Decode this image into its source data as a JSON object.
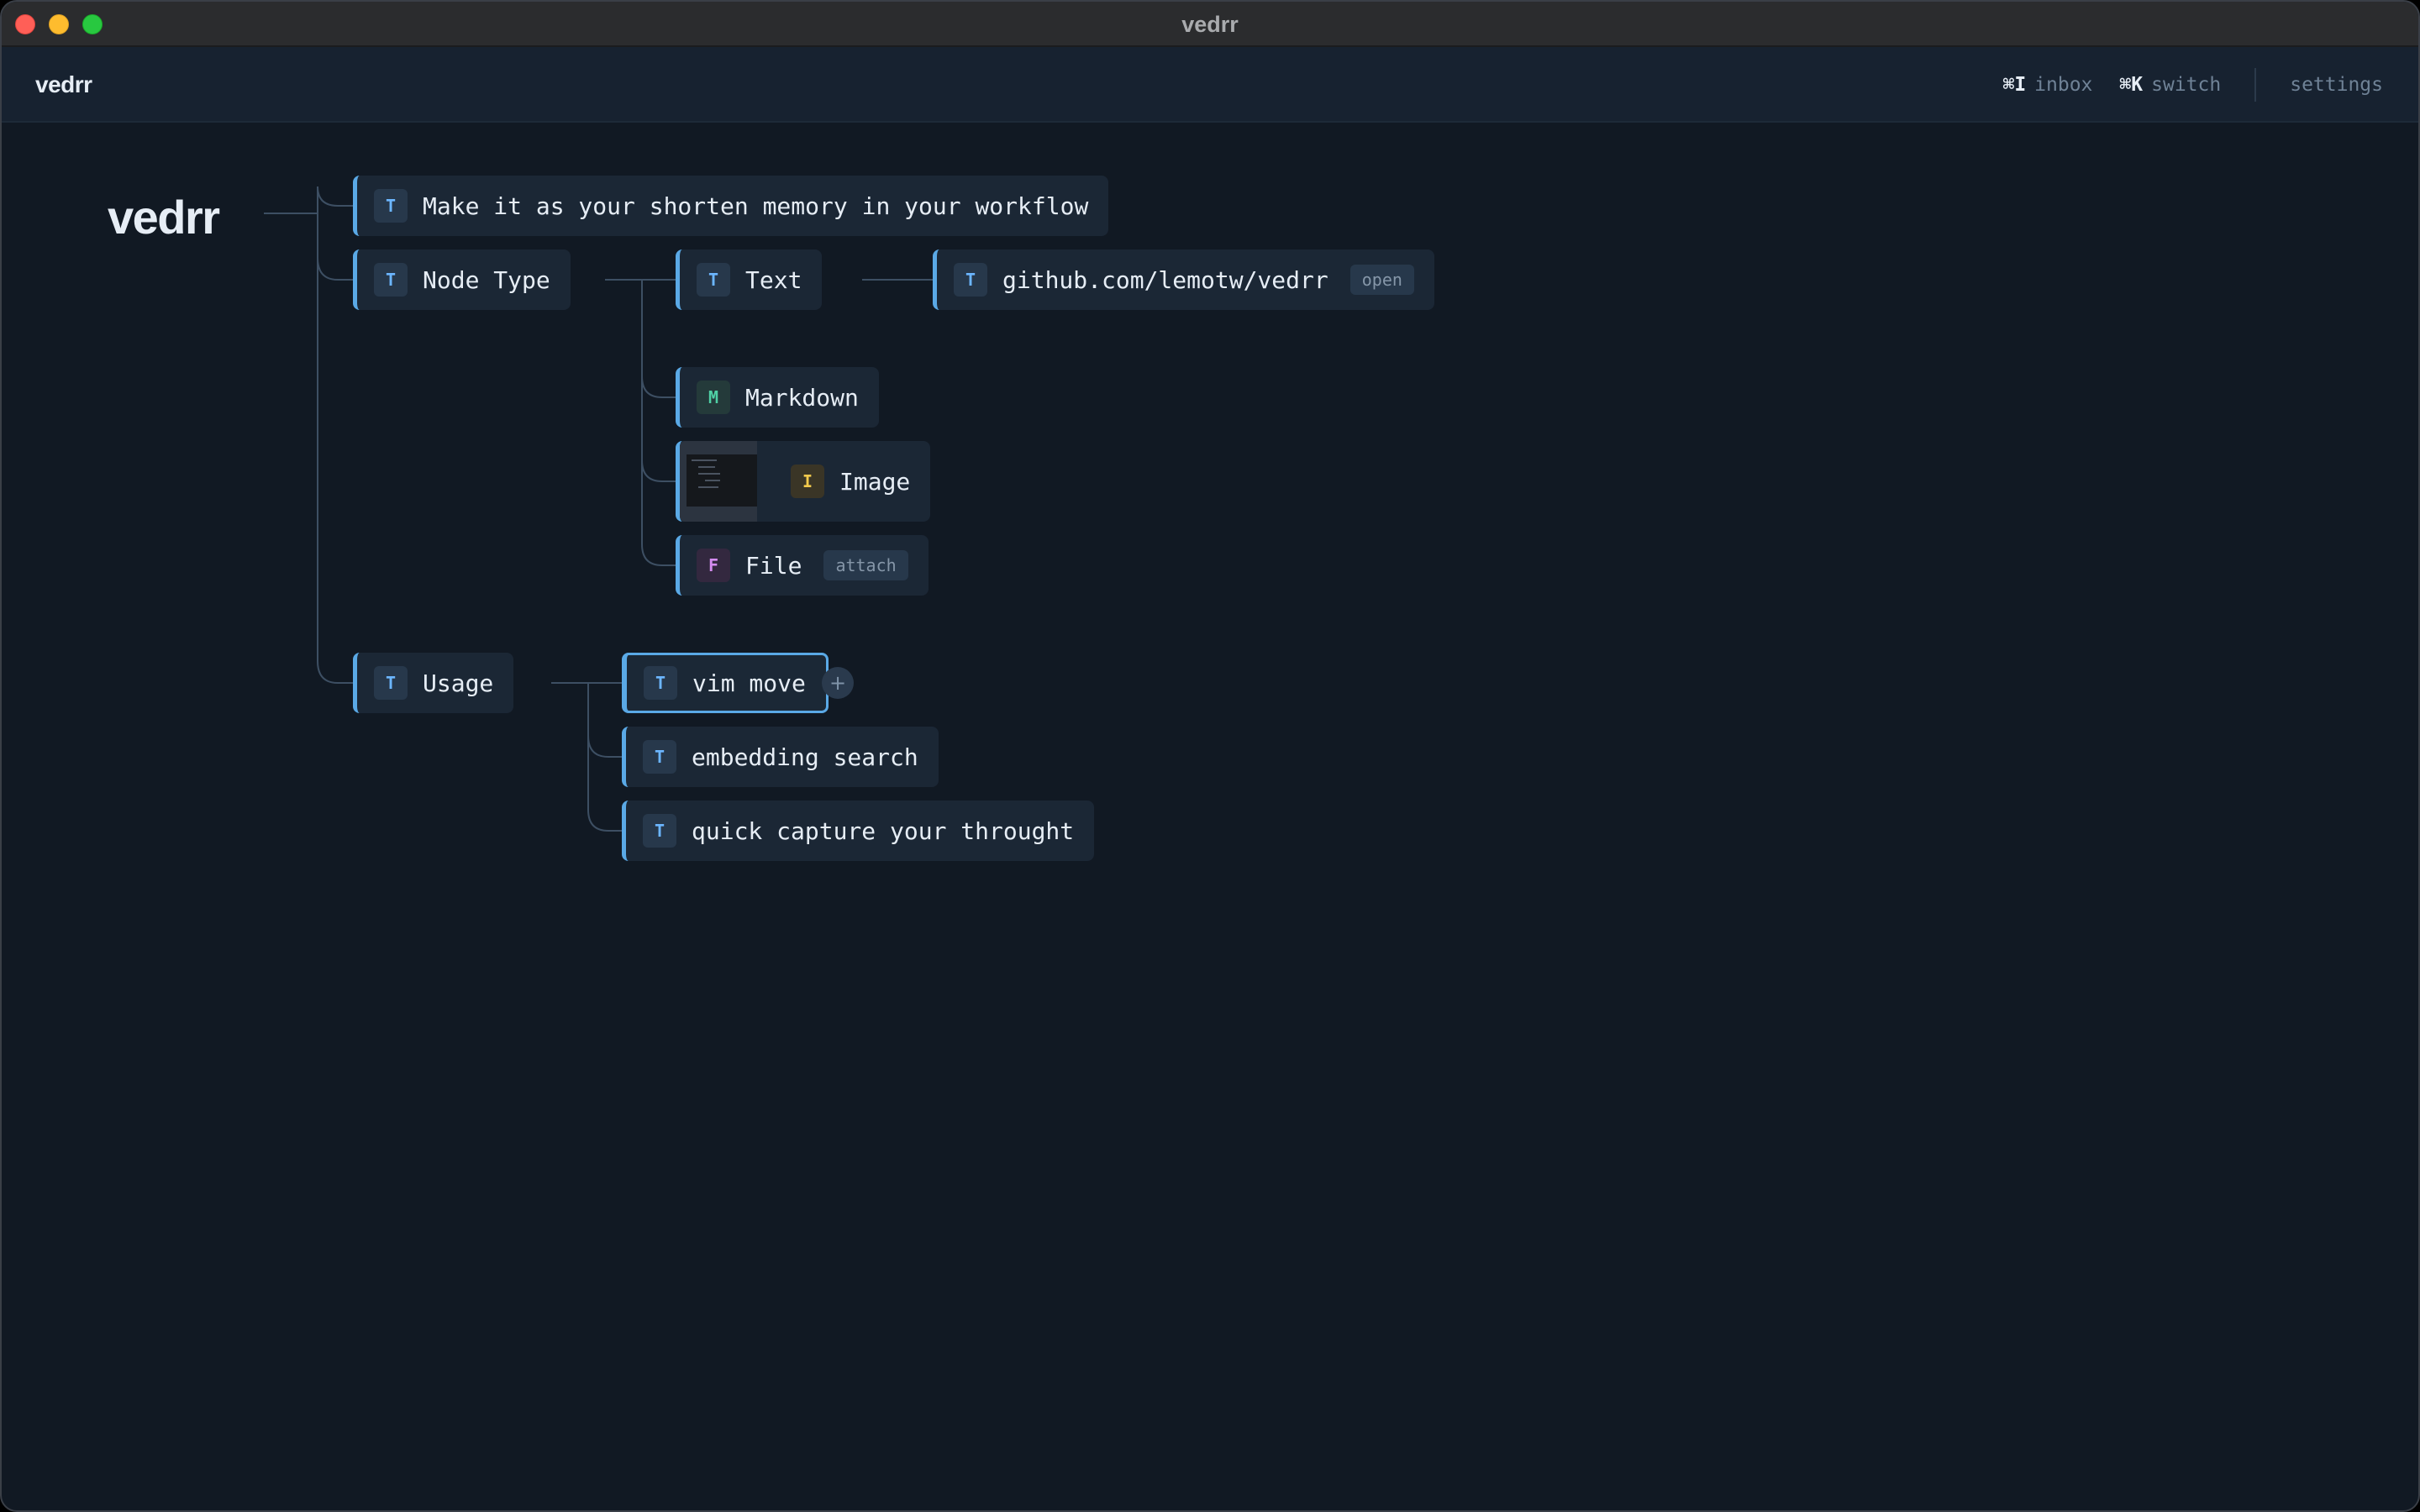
{
  "window": {
    "title": "vedrr"
  },
  "appbar": {
    "brand": "vedrr",
    "inbox": {
      "key": "⌘I",
      "label": "inbox"
    },
    "switch": {
      "key": "⌘K",
      "label": "switch"
    },
    "settings": "settings"
  },
  "tree": {
    "root": "vedrr",
    "nodes": {
      "memory": {
        "type": "T",
        "label": "Make it as your shorten memory in your workflow"
      },
      "node_type": {
        "type": "T",
        "label": "Node Type"
      },
      "text": {
        "type": "T",
        "label": "Text"
      },
      "github": {
        "type": "T",
        "label": "github.com/lemotw/vedrr",
        "tag": "open"
      },
      "markdown": {
        "type": "M",
        "label": "Markdown"
      },
      "image": {
        "type": "I",
        "label": "Image"
      },
      "file": {
        "type": "F",
        "label": "File",
        "tag": "attach"
      },
      "usage": {
        "type": "T",
        "label": "Usage"
      },
      "vim_move": {
        "type": "T",
        "label": "vim move",
        "selected": true
      },
      "embedding": {
        "type": "T",
        "label": "embedding search"
      },
      "capture": {
        "type": "T",
        "label": "quick capture your throught"
      }
    },
    "add_button": "+"
  },
  "colors": {
    "background": "#111923",
    "node_background": "#1b2735",
    "accent": "#5aa9e6",
    "text_type": "#6cb6ff",
    "markdown_type": "#4fd1a5",
    "image_type": "#f2c94c",
    "file_type": "#d58cf0"
  },
  "icons": {
    "close": "close-traffic-light",
    "minimize": "minimize-traffic-light",
    "zoom": "zoom-traffic-light",
    "add": "plus-icon"
  }
}
